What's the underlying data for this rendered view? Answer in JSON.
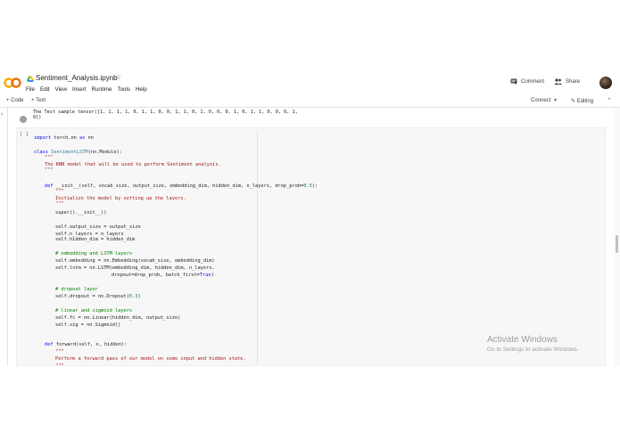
{
  "header": {
    "notebook_title": "Sentiment_Analysis.ipynb",
    "menu": [
      "File",
      "Edit",
      "View",
      "Insert",
      "Runtime",
      "Tools",
      "Help"
    ],
    "comment_label": "Comment",
    "share_label": "Share"
  },
  "toolbar": {
    "add_code_label": "+ Code",
    "add_text_label": "+ Text",
    "connect_label": "Connect",
    "editing_label": "Editing"
  },
  "output": {
    "line1": "The Test sample tensor([1, 1, 1, 1, 0, 1, 1, 0, 0, 1, 1, 0, 1, 0, 0, 0, 1, 0, 1, 1, 0, 0, 0, 1,",
    "line2": "0])"
  },
  "cell": {
    "run_indicator": "[ ]",
    "lines": [
      "import torch.nn as nn",
      "",
      "class SentimentLSTM(nn.Module):",
      "    \"\"\"",
      "    The RNN model that will be used to perform Sentiment analysis.",
      "    \"\"\"",
      "",
      "",
      "    def __init__(self, vocab_size, output_size, embedding_dim, hidden_dim, n_layers, drop_prob=0.5):",
      "        \"\"\"",
      "        Initialize the model by setting up the layers.",
      "        \"\"\"",
      "        super().__init__()",
      "",
      "        self.output_size = output_size",
      "        self.n_layers = n_layers",
      "        self.hidden_dim = hidden_dim",
      "",
      "        # embedding and LSTM layers",
      "        self.embedding = nn.Embedding(vocab_size, embedding_dim)",
      "        self.lstm = nn.LSTM(embedding_dim, hidden_dim, n_layers,",
      "                            dropout=drop_prob, batch_first=True)",
      "",
      "        # dropout layer",
      "        self.dropout = nn.Dropout(0.3)",
      "",
      "        # linear and sigmoid layers",
      "        self.fc = nn.Linear(hidden_dim, output_size)",
      "        self.sig = nn.Sigmoid()",
      "",
      "",
      "    def forward(self, x, hidden):",
      "        \"\"\"",
      "        Perform a forward pass of our model on some input and hidden state.",
      "        \"\"\""
    ]
  },
  "watermark": {
    "title": "Activate Windows",
    "subtitle": "Go to Settings to activate Windows."
  },
  "colors": {
    "keyword": "#0000ff",
    "string": "#a31515",
    "comment": "#008000",
    "number": "#098658",
    "class_name": "#267f99"
  }
}
